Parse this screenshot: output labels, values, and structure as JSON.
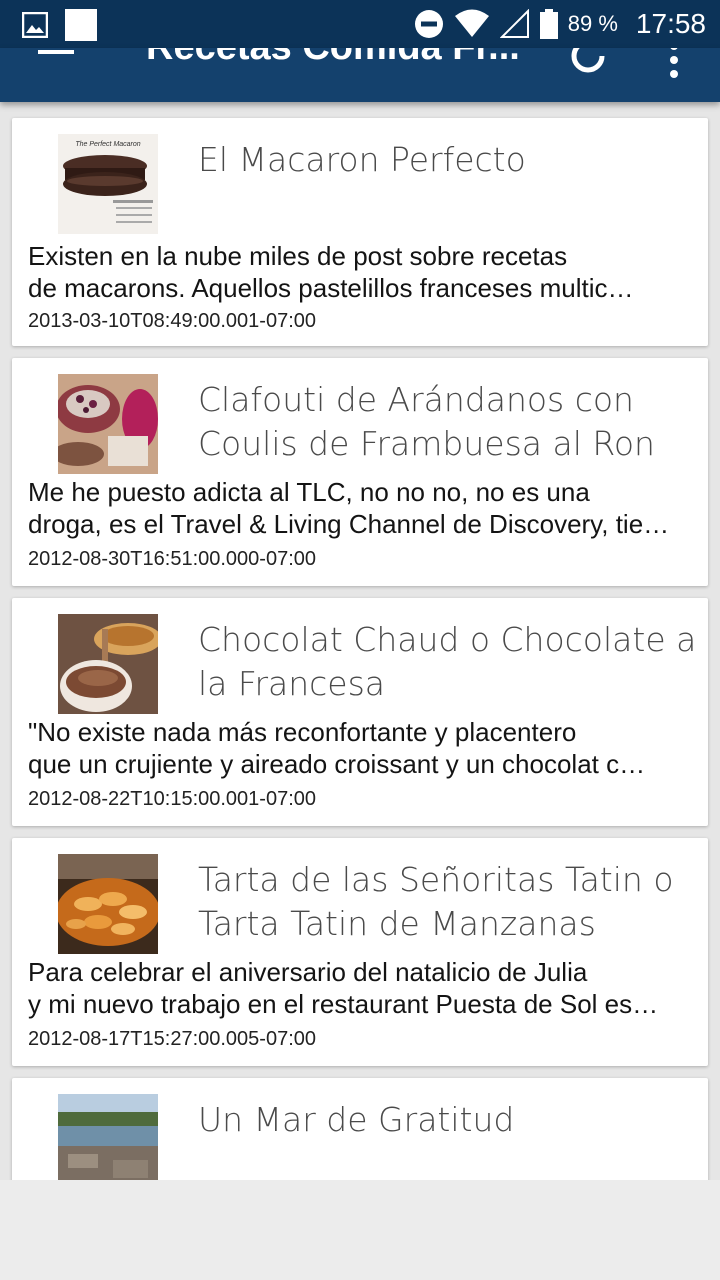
{
  "status_bar": {
    "battery_text": "89 %",
    "time": "17:58",
    "icons": [
      "image-notification-icon",
      "app-notification-icon",
      "do-not-disturb-icon",
      "wifi-icon",
      "cell-signal-icon",
      "battery-icon"
    ]
  },
  "app_bar": {
    "title": "Recetas Comida Fr...",
    "icons": [
      "menu-icon",
      "refresh-icon",
      "overflow-menu-icon"
    ]
  },
  "posts": [
    {
      "title": "El Macaron Perfecto",
      "excerpt_line1": "Existen en la nube miles de post sobre recetas",
      "excerpt_line2": "de macarons. Aquellos pastelillos franceses multic…",
      "date": "2013-03-10T08:49:00.001-07:00",
      "thumb_text": "The Perfect Macaron"
    },
    {
      "title": "Clafouti de Arándanos con Coulis de Frambuesa al Ron",
      "excerpt_line1": "Me he puesto adicta al TLC, no no no, no es una",
      "excerpt_line2": "droga, es el Travel & Living Channel de Discovery, tie…",
      "date": "2012-08-30T16:51:00.000-07:00"
    },
    {
      "title": "Chocolat Chaud o Chocolate a la Francesa",
      "excerpt_line1": "\"No existe nada más reconfortante y placentero",
      "excerpt_line2": "que un crujiente y aireado croissant y un chocolat c…",
      "date": "2012-08-22T10:15:00.001-07:00"
    },
    {
      "title": "Tarta de las Señoritas Tatin o Tarta Tatin de Manzanas",
      "excerpt_line1": "Para celebrar el aniversario del natalicio de Julia",
      "excerpt_line2": "y mi nuevo trabajo en el restaurant Puesta de Sol es…",
      "date": "2012-08-17T15:27:00.005-07:00"
    },
    {
      "title": "Un Mar de Gratitud"
    }
  ],
  "colors": {
    "status_bar": "#0c3358",
    "app_bar": "#14416d",
    "card": "#ffffff",
    "background": "#e6e6e6"
  }
}
